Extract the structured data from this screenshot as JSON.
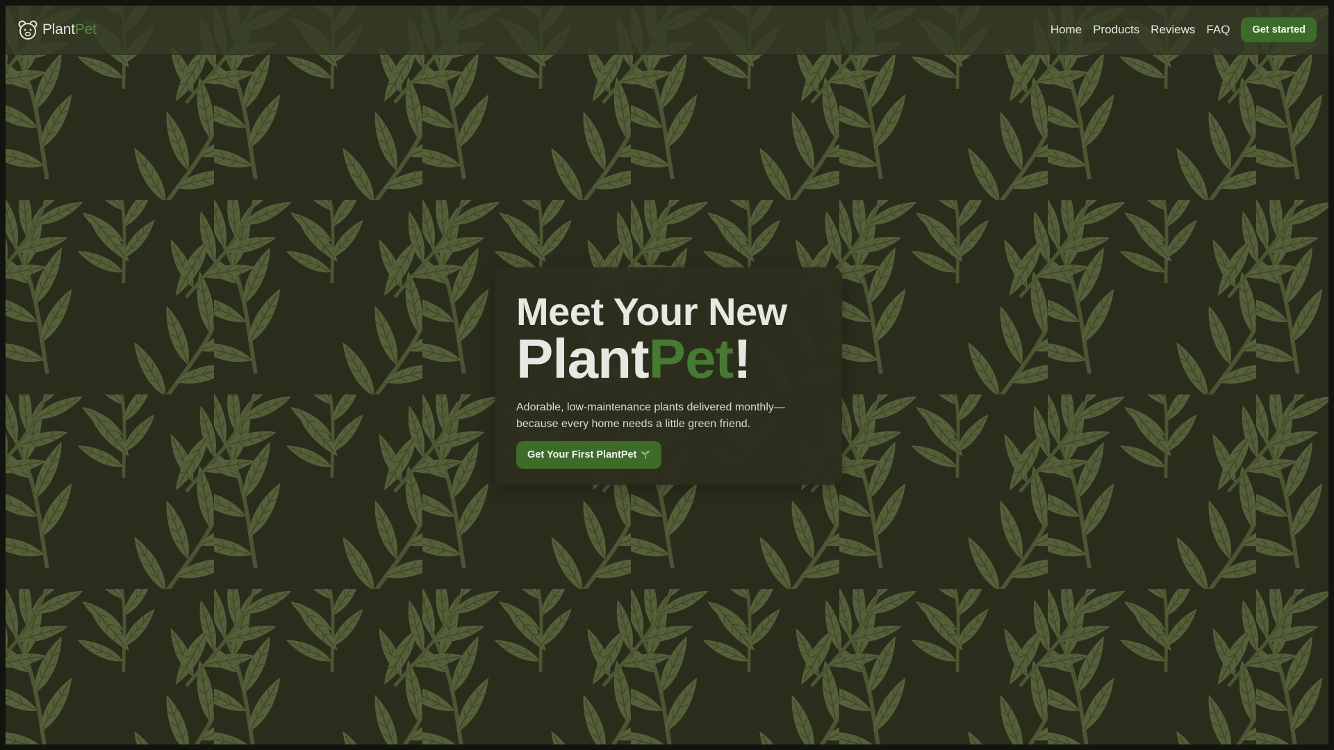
{
  "colors": {
    "background": "#2a2c1c",
    "leaf": "#55603a",
    "leaf_vein": "#414a2b",
    "navbar": "#343a24",
    "card": "#2c2d1e",
    "text": "#e6e8e2",
    "accent_green": "#467a32",
    "button_green": "#3d6b2a"
  },
  "header": {
    "brand": {
      "icon": "bear-face-icon",
      "name_part1": "Plant",
      "name_part2": "Pet"
    },
    "nav": [
      "Home",
      "Products",
      "Reviews",
      "FAQ"
    ],
    "cta_label": "Get started"
  },
  "hero": {
    "title_line1": "Meet Your New",
    "title_line2_part1": "Plant",
    "title_line2_part2": "Pet",
    "title_line2_part3": "!",
    "subtitle": "Adorable, low-maintenance plants delivered monthly—because every home needs a little green friend.",
    "cta_label": "Get Your First PlantPet",
    "cta_icon": "sprout-icon"
  }
}
